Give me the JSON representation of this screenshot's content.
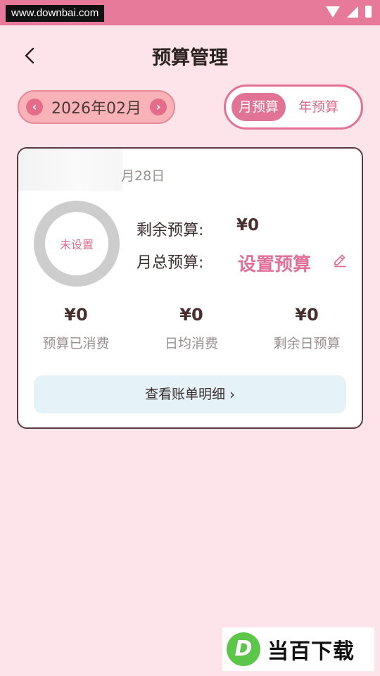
{
  "watermark": {
    "url": "www.downbai.com",
    "logo_letter": "D",
    "logo_text": "当百下载"
  },
  "header": {
    "title": "预算管理"
  },
  "month_picker": {
    "prev": "‹",
    "next": "›",
    "current": "2026年02月"
  },
  "tabs": [
    {
      "label": "月预算",
      "active": true
    },
    {
      "label": "年预算",
      "active": false
    }
  ],
  "card": {
    "date": "月28日",
    "ring_label": "未设置",
    "remaining_label": "剩余预算:",
    "remaining_value": "¥0",
    "monthly_total_label": "月总预算:",
    "set_budget_label": "设置预算",
    "stats": [
      {
        "value": "¥0",
        "label": "预算已消费"
      },
      {
        "value": "¥0",
        "label": "日均消费"
      },
      {
        "value": "¥0",
        "label": "剩余日预算"
      }
    ],
    "detail_button": "查看账单明细",
    "detail_chevron": "›"
  },
  "colors": {
    "accent": "#e07396",
    "background": "#fde3ea",
    "ring": "#cdcdcd"
  }
}
